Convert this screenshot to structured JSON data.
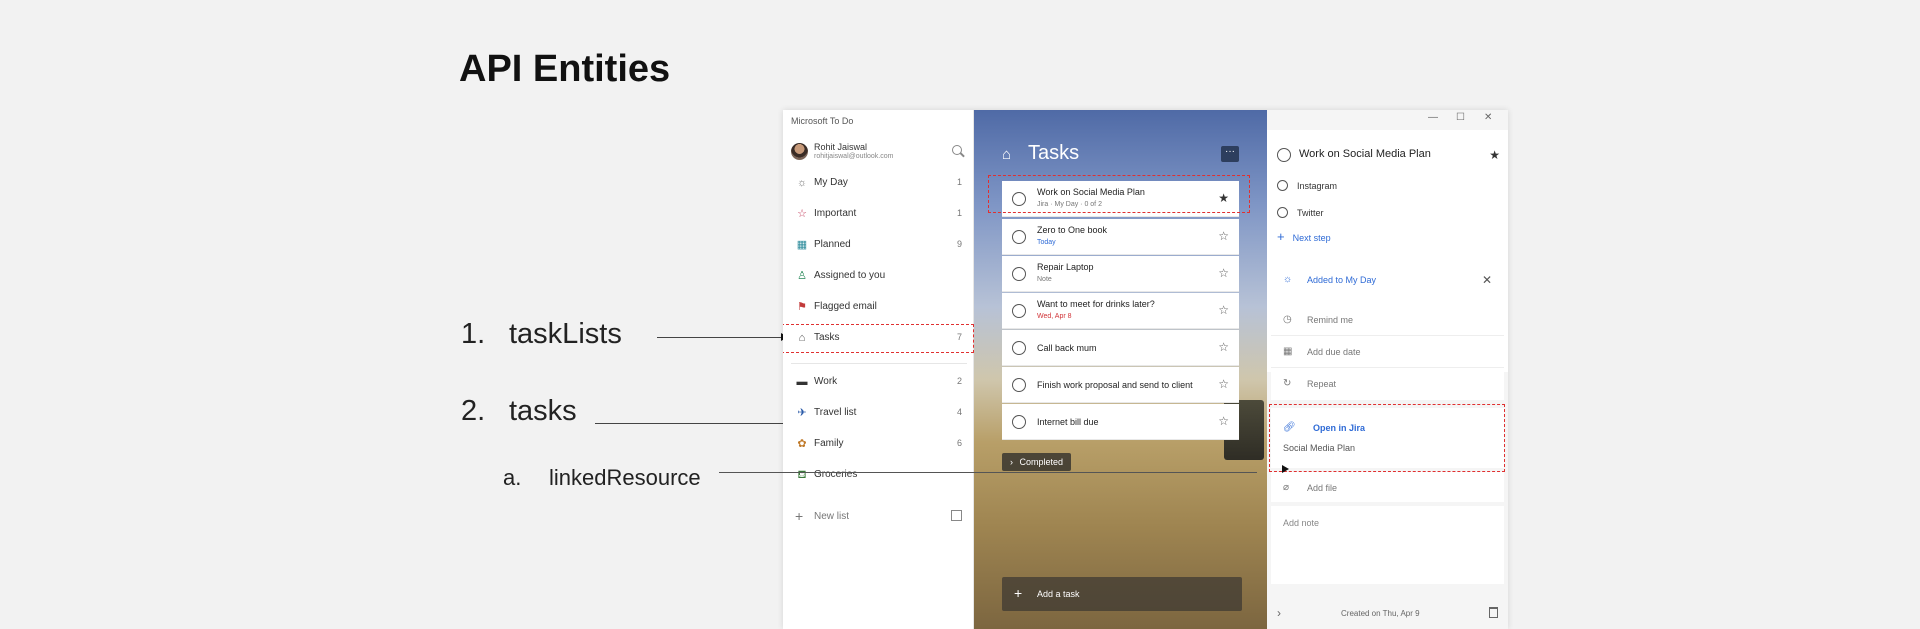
{
  "slide": {
    "title": "API Entities"
  },
  "annotations": [
    {
      "number": "1.",
      "text": "taskLists"
    },
    {
      "number": "2.",
      "text": "tasks"
    },
    {
      "number": "a.",
      "text": "linkedResource"
    }
  ],
  "app": {
    "name": "Microsoft To Do",
    "profile": {
      "name": "Rohit Jaiswal",
      "email": "rohitjaiswal@outlook.com"
    },
    "sidebar": {
      "items": [
        {
          "label": "My Day",
          "count": "1",
          "icon": "sun-icon"
        },
        {
          "label": "Important",
          "count": "1",
          "icon": "star-icon"
        },
        {
          "label": "Planned",
          "count": "9",
          "icon": "calendar-icon"
        },
        {
          "label": "Assigned to you",
          "count": "",
          "icon": "person-icon"
        },
        {
          "label": "Flagged email",
          "count": "",
          "icon": "flag-icon"
        },
        {
          "label": "Tasks",
          "count": "7",
          "icon": "home-icon"
        }
      ],
      "lists": [
        {
          "label": "Work",
          "count": "2"
        },
        {
          "label": "Travel list",
          "count": "4"
        },
        {
          "label": "Family",
          "count": "6"
        },
        {
          "label": "Groceries",
          "count": ""
        }
      ],
      "new_list_label": "New list"
    },
    "tasks_pane": {
      "title": "Tasks",
      "more_label": "···",
      "tasks": [
        {
          "title": "Work on Social Media Plan",
          "meta": "Jira · My Day · 0 of 2",
          "starred": true
        },
        {
          "title": "Zero to One book",
          "meta": "Today",
          "starred": false
        },
        {
          "title": "Repair Laptop",
          "meta": "Note",
          "starred": false
        },
        {
          "title": "Want to meet for drinks later?",
          "meta": "Wed, Apr 8",
          "starred": false
        },
        {
          "title": "Call back mum",
          "meta": "",
          "starred": false
        },
        {
          "title": "Finish work proposal and send to client",
          "meta": "",
          "starred": false
        },
        {
          "title": "Internet bill due",
          "meta": "",
          "starred": false
        }
      ],
      "completed_label": "Completed",
      "add_task_label": "Add a task"
    },
    "detail_pane": {
      "window_controls": [
        "—",
        "☐",
        "✕"
      ],
      "task_title": "Work on Social Media Plan",
      "steps": [
        "Instagram",
        "Twitter"
      ],
      "next_step_label": "Next step",
      "my_day_label": "Added to My Day",
      "remind_label": "Remind me",
      "due_label": "Add due date",
      "repeat_label": "Repeat",
      "linked": {
        "label": "Open in Jira",
        "sub": "Social Media Plan"
      },
      "add_file_label": "Add file",
      "add_note_label": "Add note",
      "footer_text": "Created on Thu, Apr 9"
    },
    "colors": {
      "accent": "#2f6bd6",
      "highlight": "#e03030"
    }
  }
}
